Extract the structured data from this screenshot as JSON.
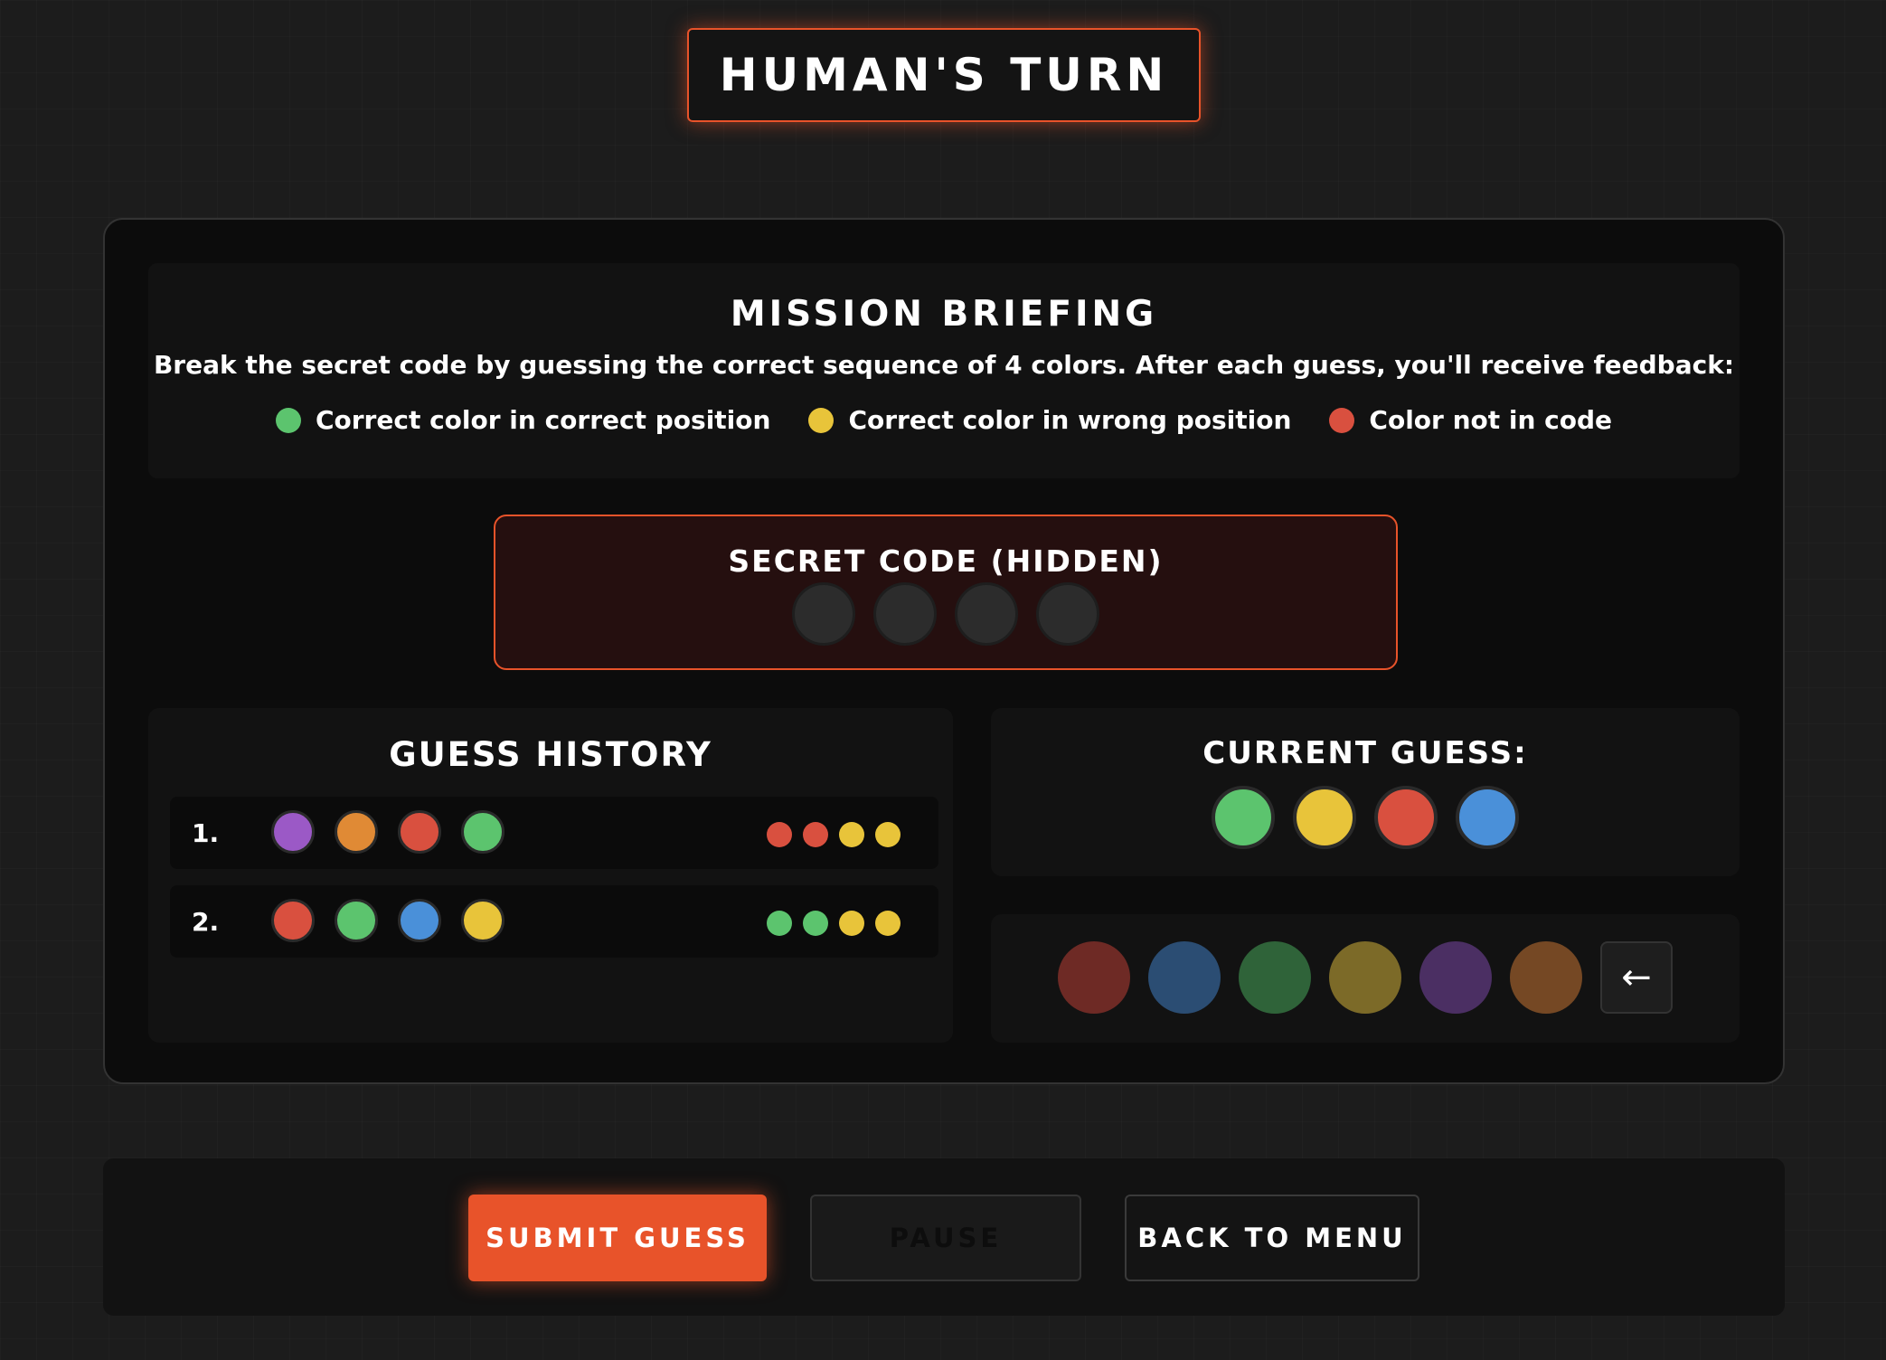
{
  "turn_banner": "HUMAN'S TURN",
  "briefing": {
    "title": "MISSION BRIEFING",
    "text": "Break the secret code by guessing the correct sequence of 4 colors. After each guess, you'll receive feedback:",
    "legend": [
      {
        "label": "Correct color in correct position",
        "color": "#5cc46e"
      },
      {
        "label": "Correct color in wrong position",
        "color": "#e8c43a"
      },
      {
        "label": "Color not in code",
        "color": "#d9503f"
      }
    ]
  },
  "secret_code": {
    "title": "SECRET CODE (HIDDEN)",
    "slots": 4
  },
  "history": {
    "title": "GUESS HISTORY",
    "rows": [
      {
        "number": "1.",
        "pegs": [
          "#9b59c6",
          "#e08a35",
          "#d9503f",
          "#5cc46e"
        ],
        "feedback": [
          "#d9503f",
          "#d9503f",
          "#e8c43a",
          "#e8c43a"
        ]
      },
      {
        "number": "2.",
        "pegs": [
          "#d9503f",
          "#5cc46e",
          "#4a90d9",
          "#e8c43a"
        ],
        "feedback": [
          "#5cc46e",
          "#5cc46e",
          "#e8c43a",
          "#e8c43a"
        ]
      }
    ]
  },
  "current_guess": {
    "title": "CURRENT GUESS:",
    "pegs": [
      "#5cc46e",
      "#e8c43a",
      "#d9503f",
      "#4a90d9"
    ]
  },
  "palette": {
    "colors": [
      {
        "name": "red",
        "color": "#6e2a25"
      },
      {
        "name": "blue",
        "color": "#2b4d73"
      },
      {
        "name": "green",
        "color": "#2f6339"
      },
      {
        "name": "yellow",
        "color": "#7c6a28"
      },
      {
        "name": "purple",
        "color": "#4b2f63"
      },
      {
        "name": "orange",
        "color": "#754824"
      }
    ],
    "backspace_icon": "left-arrow-icon",
    "backspace_glyph": "←"
  },
  "controls": {
    "submit_label": "SUBMIT GUESS",
    "pause_label": "PAUSE",
    "back_label": "BACK TO MENU"
  }
}
